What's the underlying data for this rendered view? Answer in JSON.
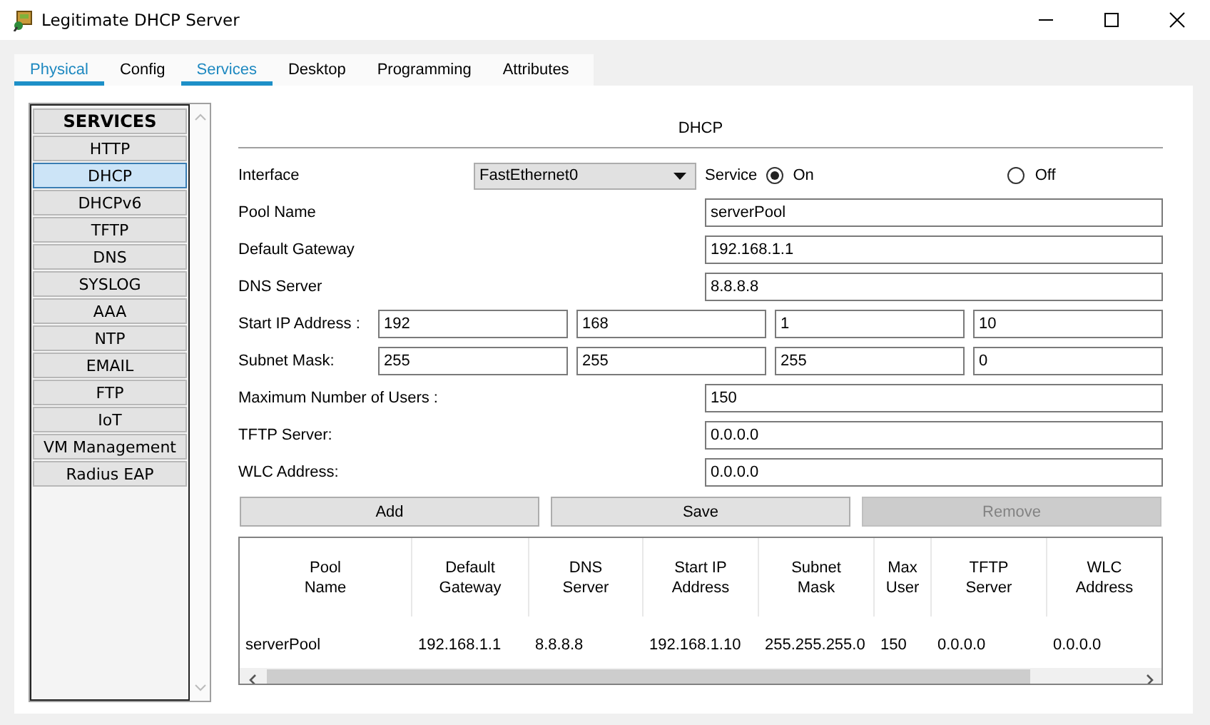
{
  "window": {
    "title": "Legitimate DHCP Server"
  },
  "tabs": [
    {
      "label": "Physical",
      "selected": true
    },
    {
      "label": "Config",
      "selected": false
    },
    {
      "label": "Services",
      "selected": true
    },
    {
      "label": "Desktop",
      "selected": false
    },
    {
      "label": "Programming",
      "selected": false
    },
    {
      "label": "Attributes",
      "selected": false
    }
  ],
  "services": {
    "header": "SERVICES",
    "items": [
      {
        "label": "HTTP",
        "selected": false
      },
      {
        "label": "DHCP",
        "selected": true
      },
      {
        "label": "DHCPv6",
        "selected": false
      },
      {
        "label": "TFTP",
        "selected": false
      },
      {
        "label": "DNS",
        "selected": false
      },
      {
        "label": "SYSLOG",
        "selected": false
      },
      {
        "label": "AAA",
        "selected": false
      },
      {
        "label": "NTP",
        "selected": false
      },
      {
        "label": "EMAIL",
        "selected": false
      },
      {
        "label": "FTP",
        "selected": false
      },
      {
        "label": "IoT",
        "selected": false
      },
      {
        "label": "VM Management",
        "selected": false
      },
      {
        "label": "Radius EAP",
        "selected": false
      }
    ]
  },
  "dhcp": {
    "title": "DHCP",
    "interface": {
      "label": "Interface",
      "value": "FastEthernet0"
    },
    "service": {
      "label": "Service",
      "options": [
        {
          "label": "On",
          "selected": true
        },
        {
          "label": "Off",
          "selected": false
        }
      ]
    },
    "fields": [
      {
        "kind": "single",
        "label": "Pool Name",
        "value": "serverPool"
      },
      {
        "kind": "single",
        "label": "Default Gateway",
        "value": "192.168.1.1"
      },
      {
        "kind": "single",
        "label": "DNS Server",
        "value": "8.8.8.8"
      },
      {
        "kind": "quad",
        "label": "Start IP Address :",
        "values": [
          "192",
          "168",
          "1",
          "10"
        ]
      },
      {
        "kind": "quad",
        "label": "Subnet Mask:",
        "values": [
          "255",
          "255",
          "255",
          "0"
        ]
      },
      {
        "kind": "single",
        "label": "Maximum Number of Users :",
        "value": "150"
      },
      {
        "kind": "single",
        "label": "TFTP Server:",
        "value": "0.0.0.0"
      },
      {
        "kind": "single",
        "label": "WLC Address:",
        "value": "0.0.0.0"
      }
    ],
    "buttons": [
      {
        "label": "Add",
        "disabled": false
      },
      {
        "label": "Save",
        "disabled": false
      },
      {
        "label": "Remove",
        "disabled": true
      }
    ],
    "table": {
      "columns": [
        "Pool Name",
        "Default Gateway",
        "DNS Server",
        "Start IP Address",
        "Subnet Mask",
        "Max User",
        "TFTP Server",
        "WLC Address"
      ],
      "rows": [
        [
          "serverPool",
          "192.168.1.1",
          "8.8.8.8",
          "192.168.1.10",
          "255.255.255.0",
          "150",
          "0.0.0.0",
          "0.0.0.0"
        ]
      ]
    }
  }
}
